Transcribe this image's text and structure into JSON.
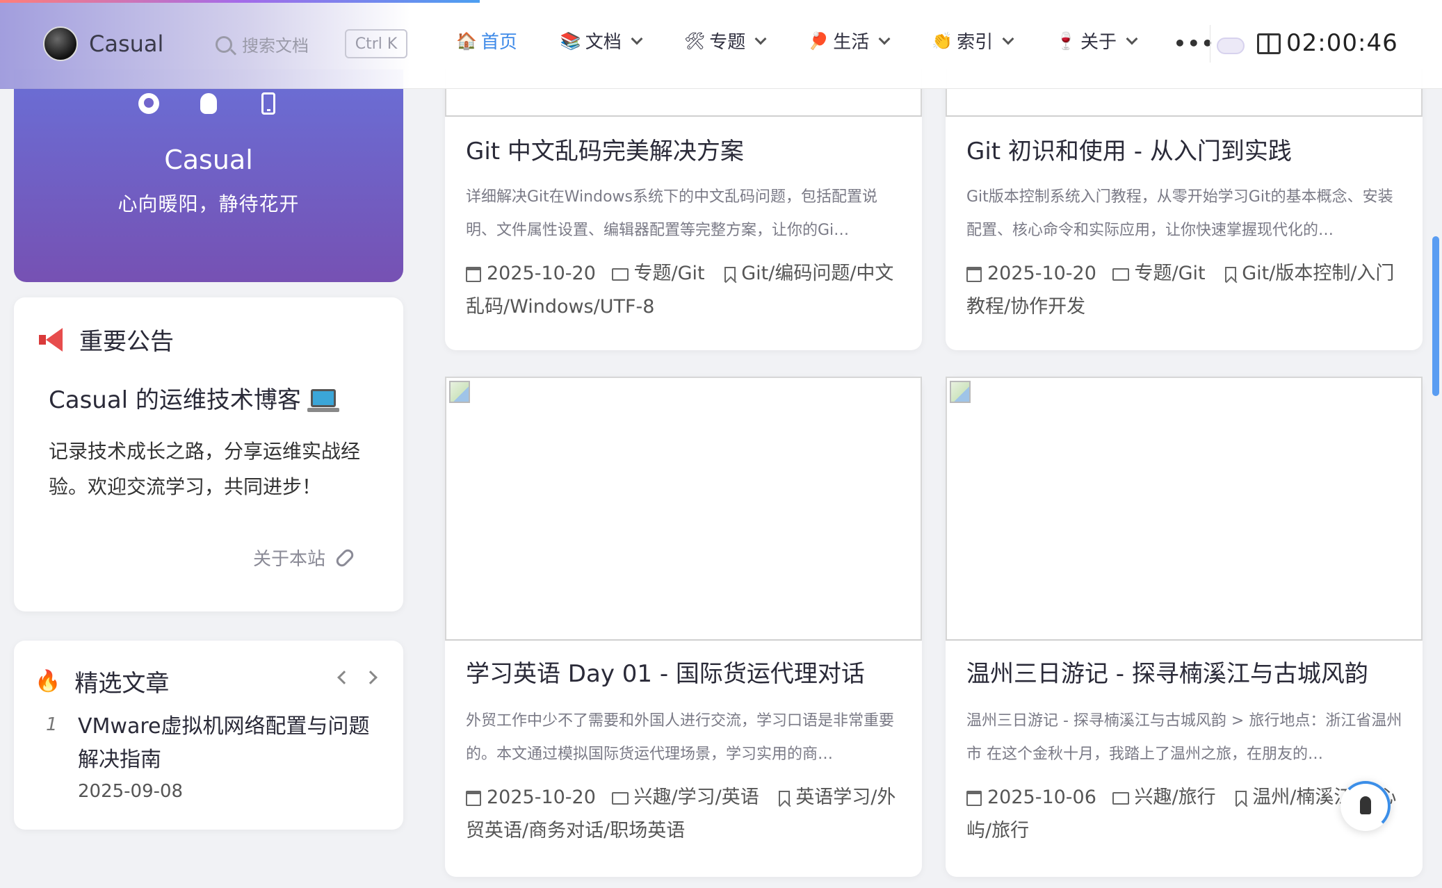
{
  "nav": {
    "brand": "Casual",
    "search_placeholder": "搜索文档",
    "search_shortcut": "Ctrl K",
    "items": [
      {
        "emoji": "🏠",
        "label": "首页"
      },
      {
        "emoji": "📚",
        "label": "文档"
      },
      {
        "emoji": "🛠",
        "label": "专题"
      },
      {
        "emoji": "🏓",
        "label": "生活"
      },
      {
        "emoji": "👏",
        "label": "索引"
      },
      {
        "emoji": "🍷",
        "label": "关于"
      }
    ],
    "more": "•••",
    "clock": "02:00:46"
  },
  "profile": {
    "name": "Casual",
    "motto": "心向暖阳，静待花开"
  },
  "notice": {
    "heading": "重要公告",
    "title": "Casual 的运维技术博客",
    "body": "记录技术成长之路，分享运维实战经验。欢迎交流学习，共同进步！",
    "link": "关于本站"
  },
  "featured": {
    "heading": "精选文章",
    "number": "1",
    "title": "VMware虚拟机网络配置与问题解决指南",
    "date": "2025-09-08"
  },
  "posts": [
    {
      "title": "Git 中文乱码完美解决方案",
      "excerpt": "详细解决Git在Windows系统下的中文乱码问题，包括配置说明、文件属性设置、编辑器配置等完整方案，让你的Gi…",
      "date": "2025-10-20",
      "category": "专题/Git",
      "tags": "Git/编码问题/中文乱码/Windows/UTF-8"
    },
    {
      "title": "Git 初识和使用 - 从入门到实践",
      "excerpt": "Git版本控制系统入门教程，从零开始学习Git的基本概念、安装配置、核心命令和实际应用，让你快速掌握现代化的…",
      "date": "2025-10-20",
      "category": "专题/Git",
      "tags": "Git/版本控制/入门教程/协作开发"
    },
    {
      "title": "学习英语 Day 01 - 国际货运代理对话",
      "excerpt": "外贸工作中少不了需要和外国人进行交流，学习口语是非常重要的。本文通过模拟国际货运代理场景，学习实用的商…",
      "date": "2025-10-20",
      "category": "兴趣/学习/英语",
      "tags": "英语学习/外贸英语/商务对话/职场英语"
    },
    {
      "title": "温州三日游记 - 探寻楠溪江与古城风韵",
      "excerpt": "温州三日游记 - 探寻楠溪江与古城风韵 > 旅行地点：浙江省温州市 在这个金秋十月，我踏上了温州之旅，在朋友的…",
      "date": "2025-10-06",
      "category": "兴趣/旅行",
      "tags": "温州/楠溪江/江心屿/旅行"
    }
  ],
  "colors": {
    "accent": "#3e8ae8",
    "profile_gradient_start": "#6a6fd6",
    "profile_gradient_end": "#7651b3"
  }
}
